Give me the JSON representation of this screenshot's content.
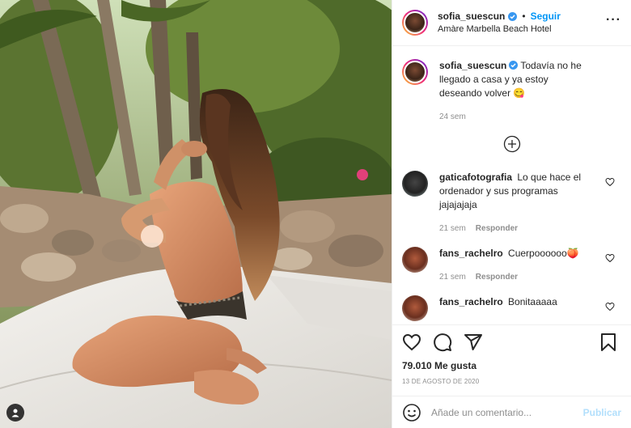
{
  "header": {
    "username": "sofia_suescun",
    "follow_label": "Seguir",
    "separator": "•",
    "location": "Amàre Marbella Beach Hotel",
    "more_icon": "more-horizontal-icon"
  },
  "caption": {
    "username": "sofia_suescun",
    "text": "Todavía no he llegado a casa y ya estoy deseando volver 😋",
    "time": "24 sem"
  },
  "comments": [
    {
      "username": "gaticafotografia",
      "text": "Lo que hace el ordenador y sus programas jajajajaja",
      "time": "21 sem",
      "reply_label": "Responder"
    },
    {
      "username": "fans_rachelro",
      "text": "Cuerpoooooo🍑",
      "time": "21 sem",
      "reply_label": "Responder"
    },
    {
      "username": "fans_rachelro",
      "text": "Bonitaaaaa"
    }
  ],
  "actions": {
    "likes": "79.010 Me gusta",
    "date": "13 DE AGOSTO DE 2020",
    "icons": [
      "heart-icon",
      "comment-icon",
      "share-icon",
      "bookmark-icon"
    ]
  },
  "add_comment": {
    "placeholder": "Añade un comentario...",
    "publish_label": "Publicar"
  },
  "colors": {
    "accent": "#0095f6",
    "publish_disabled": "#b2dffc",
    "muted": "#8e8e8e",
    "text": "#262626"
  }
}
